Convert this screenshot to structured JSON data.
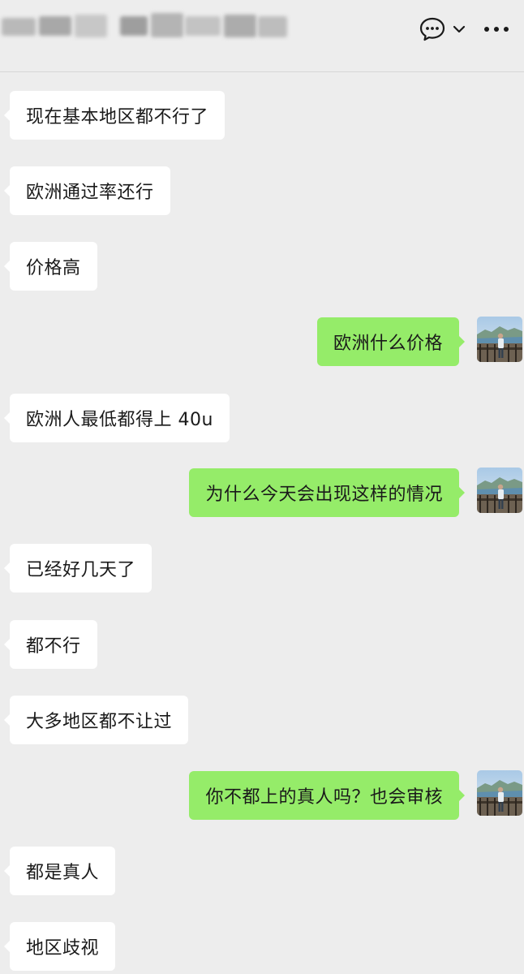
{
  "header": {
    "title_blurred": true,
    "icons": {
      "chat": "chat-bubble-icon",
      "chevron": "chevron-down-icon",
      "more": "more-icon"
    }
  },
  "colors": {
    "background": "#ededed",
    "received_bubble": "#ffffff",
    "sent_bubble": "#95ec69",
    "text": "#1a1a1a"
  },
  "messages": [
    {
      "from": "other",
      "text": "现在基本地区都不行了"
    },
    {
      "from": "other",
      "text": "欧洲通过率还行"
    },
    {
      "from": "other",
      "text": "价格高"
    },
    {
      "from": "me",
      "text": "欧洲什么价格"
    },
    {
      "from": "other",
      "text": "欧洲人最低都得上 40u"
    },
    {
      "from": "me",
      "text": "为什么今天会出现这样的情况"
    },
    {
      "from": "other",
      "text": "已经好几天了"
    },
    {
      "from": "other",
      "text": "都不行"
    },
    {
      "from": "other",
      "text": "大多地区都不让过"
    },
    {
      "from": "me",
      "text": "你不都上的真人吗？也会审核"
    },
    {
      "from": "other",
      "text": "都是真人"
    },
    {
      "from": "other",
      "text": "地区歧视"
    }
  ]
}
